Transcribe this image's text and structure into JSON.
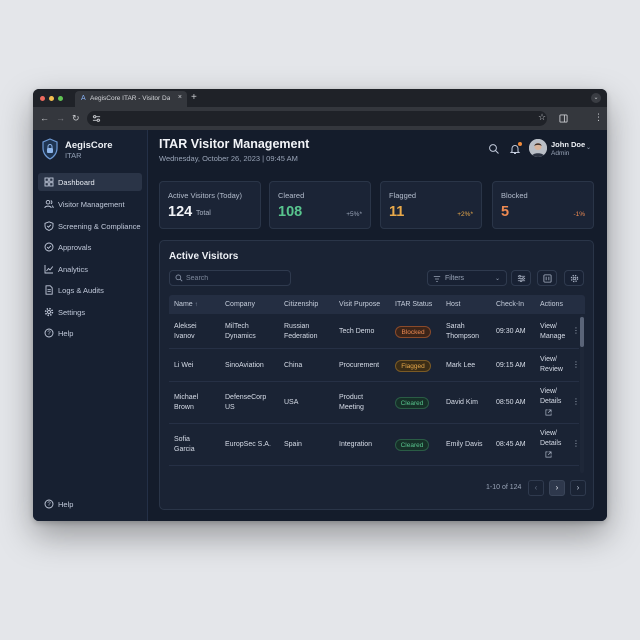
{
  "browser": {
    "tab_title": "AegisCore ITAR - Visitor Dash",
    "tab_favicon": "A",
    "close_glyph": "×",
    "new_tab_glyph": "+"
  },
  "sidebar": {
    "brand": "AegisCore",
    "brand_sub": "ITAR",
    "items": [
      {
        "label": "Dashboard",
        "icon": "grid-icon"
      },
      {
        "label": "Visitor Management",
        "icon": "users-icon"
      },
      {
        "label": "Screening & Compliance",
        "icon": "shield-check-icon"
      },
      {
        "label": "Approvals",
        "icon": "check-circle-icon"
      },
      {
        "label": "Analytics",
        "icon": "chart-line-icon"
      },
      {
        "label": "Logs & Audits",
        "icon": "document-icon"
      },
      {
        "label": "Settings",
        "icon": "gear-icon"
      },
      {
        "label": "Help",
        "icon": "help-circle-icon"
      }
    ],
    "footer_help": "Help"
  },
  "header": {
    "title": "ITAR Visitor Management",
    "date": "Wednesday, October 26, 2023 | 09:45 AM",
    "user_name": "John Doe",
    "user_role": "Admin"
  },
  "stats": [
    {
      "label": "Active Visitors (Today)",
      "value": "124",
      "sub": "Total",
      "delta": "",
      "color": "#f2f4f8"
    },
    {
      "label": "Cleared",
      "value": "108",
      "sub": "",
      "delta": "+5%*",
      "color": "#58c48e"
    },
    {
      "label": "Flagged",
      "value": "11",
      "sub": "",
      "delta": "+2%*",
      "color": "#e9a94a"
    },
    {
      "label": "Blocked",
      "value": "5",
      "sub": "",
      "delta": "-1%",
      "color": "#ee8a52"
    }
  ],
  "panel": {
    "title": "Active Visitors",
    "search_placeholder": "Search",
    "filters_label": "Filters",
    "columns": [
      "Name",
      "Company",
      "Citizenship",
      "Visit Purpose",
      "ITAR Status",
      "Host",
      "Check-In",
      "Actions"
    ],
    "sort_glyph": "↑",
    "rows": [
      {
        "name": [
          "Aleksei",
          "Ivanov"
        ],
        "company": [
          "MilTech",
          "Dynamics"
        ],
        "citizenship": [
          "Russian",
          "Federation"
        ],
        "purpose": [
          "Tech Demo"
        ],
        "status": "Blocked",
        "status_kind": "blocked",
        "host": [
          "Sarah",
          "Thompson"
        ],
        "checkin": "09:30 AM",
        "actions": [
          "View/",
          "Manage"
        ],
        "ext": false
      },
      {
        "name": [
          "Li Wei"
        ],
        "company": [
          "SinoAviation"
        ],
        "citizenship": [
          "China"
        ],
        "purpose": [
          "Procurement"
        ],
        "status": "Flagged",
        "status_kind": "flagged",
        "host": [
          "Mark Lee"
        ],
        "checkin": "09:15 AM",
        "actions": [
          "View/",
          "Review"
        ],
        "ext": false
      },
      {
        "name": [
          "Michael",
          "Brown"
        ],
        "company": [
          "DefenseCorp",
          "US"
        ],
        "citizenship": [
          "USA"
        ],
        "purpose": [
          "Product",
          "Meeting"
        ],
        "status": "Cleared",
        "status_kind": "cleared",
        "host": [
          "David Kim"
        ],
        "checkin": "08:50 AM",
        "actions": [
          "View/",
          "Details"
        ],
        "ext": true
      },
      {
        "name": [
          "Sofia",
          "Garcia"
        ],
        "company": [
          "EuropSec S.A."
        ],
        "citizenship": [
          "Spain"
        ],
        "purpose": [
          "Integration"
        ],
        "status": "Cleared",
        "status_kind": "cleared",
        "host": [
          "Emily Davis"
        ],
        "checkin": "08:45 AM",
        "actions": [
          "View/",
          "Details"
        ],
        "ext": true
      }
    ],
    "pagination": "1-10 of 124",
    "prev_glyph": "‹",
    "current_glyph": "›",
    "next_glyph": "›"
  }
}
